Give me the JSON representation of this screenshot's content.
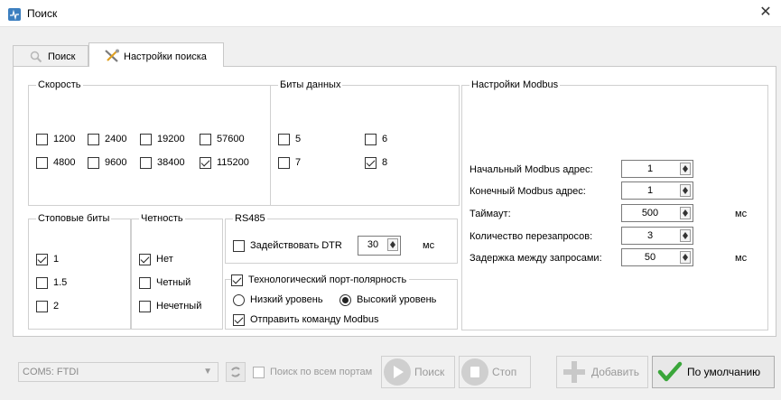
{
  "window": {
    "title": "Поиск",
    "close": "✕"
  },
  "tabs": [
    {
      "label": "Поиск",
      "active": false
    },
    {
      "label": "Настройки поиска",
      "active": true
    }
  ],
  "speed": {
    "title": "Скорость",
    "options": [
      {
        "label": "1200",
        "checked": false
      },
      {
        "label": "2400",
        "checked": false
      },
      {
        "label": "19200",
        "checked": false
      },
      {
        "label": "57600",
        "checked": false
      },
      {
        "label": "4800",
        "checked": false
      },
      {
        "label": "9600",
        "checked": false
      },
      {
        "label": "38400",
        "checked": false
      },
      {
        "label": "115200",
        "checked": true
      }
    ]
  },
  "data_bits": {
    "title": "Биты данных",
    "options": [
      {
        "label": "5",
        "checked": false
      },
      {
        "label": "6",
        "checked": false
      },
      {
        "label": "7",
        "checked": false
      },
      {
        "label": "8",
        "checked": true
      }
    ]
  },
  "stop_bits": {
    "title": "Стоповые биты",
    "options": [
      {
        "label": "1",
        "checked": true
      },
      {
        "label": "1.5",
        "checked": false
      },
      {
        "label": "2",
        "checked": false
      }
    ]
  },
  "parity": {
    "title": "Четность",
    "options": [
      {
        "label": "Нет",
        "checked": true
      },
      {
        "label": "Четный",
        "checked": false
      },
      {
        "label": "Нечетный",
        "checked": false
      }
    ]
  },
  "rs485": {
    "title": "RS485",
    "dtr_label": "Задействовать DTR",
    "dtr_checked": false,
    "dtr_value": "30",
    "dtr_unit": "мс"
  },
  "tech_port": {
    "title": "Технологический порт-полярность",
    "checked": true,
    "low_label": "Низкий уровень",
    "high_label": "Высокий уровень",
    "selected": "high",
    "send_modbus_label": "Отправить команду Modbus",
    "send_modbus_checked": true
  },
  "modbus": {
    "title": "Настройки Modbus",
    "start_label": "Начальный  Modbus адрес:",
    "start_value": "1",
    "end_label": "Конечный  Modbus адрес:",
    "end_value": "1",
    "timeout_label": "Таймаут:",
    "timeout_value": "500",
    "timeout_unit": "мс",
    "retries_label": "Количество перезапросов:",
    "retries_value": "3",
    "delay_label": "Задержка между запросами:",
    "delay_value": "50",
    "delay_unit": "мс"
  },
  "bottom": {
    "port_value": "COM5: FTDI",
    "search_all_label": "Поиск по всем портам",
    "search_all_checked": false,
    "search_btn": "Поиск",
    "stop_btn": "Стоп",
    "add_btn": "Добавить",
    "default_btn": "По умолчанию"
  },
  "colors": {
    "accent": "#3c7fc0",
    "check_green": "#3aa63a",
    "disabled": "#9a9a9a"
  }
}
